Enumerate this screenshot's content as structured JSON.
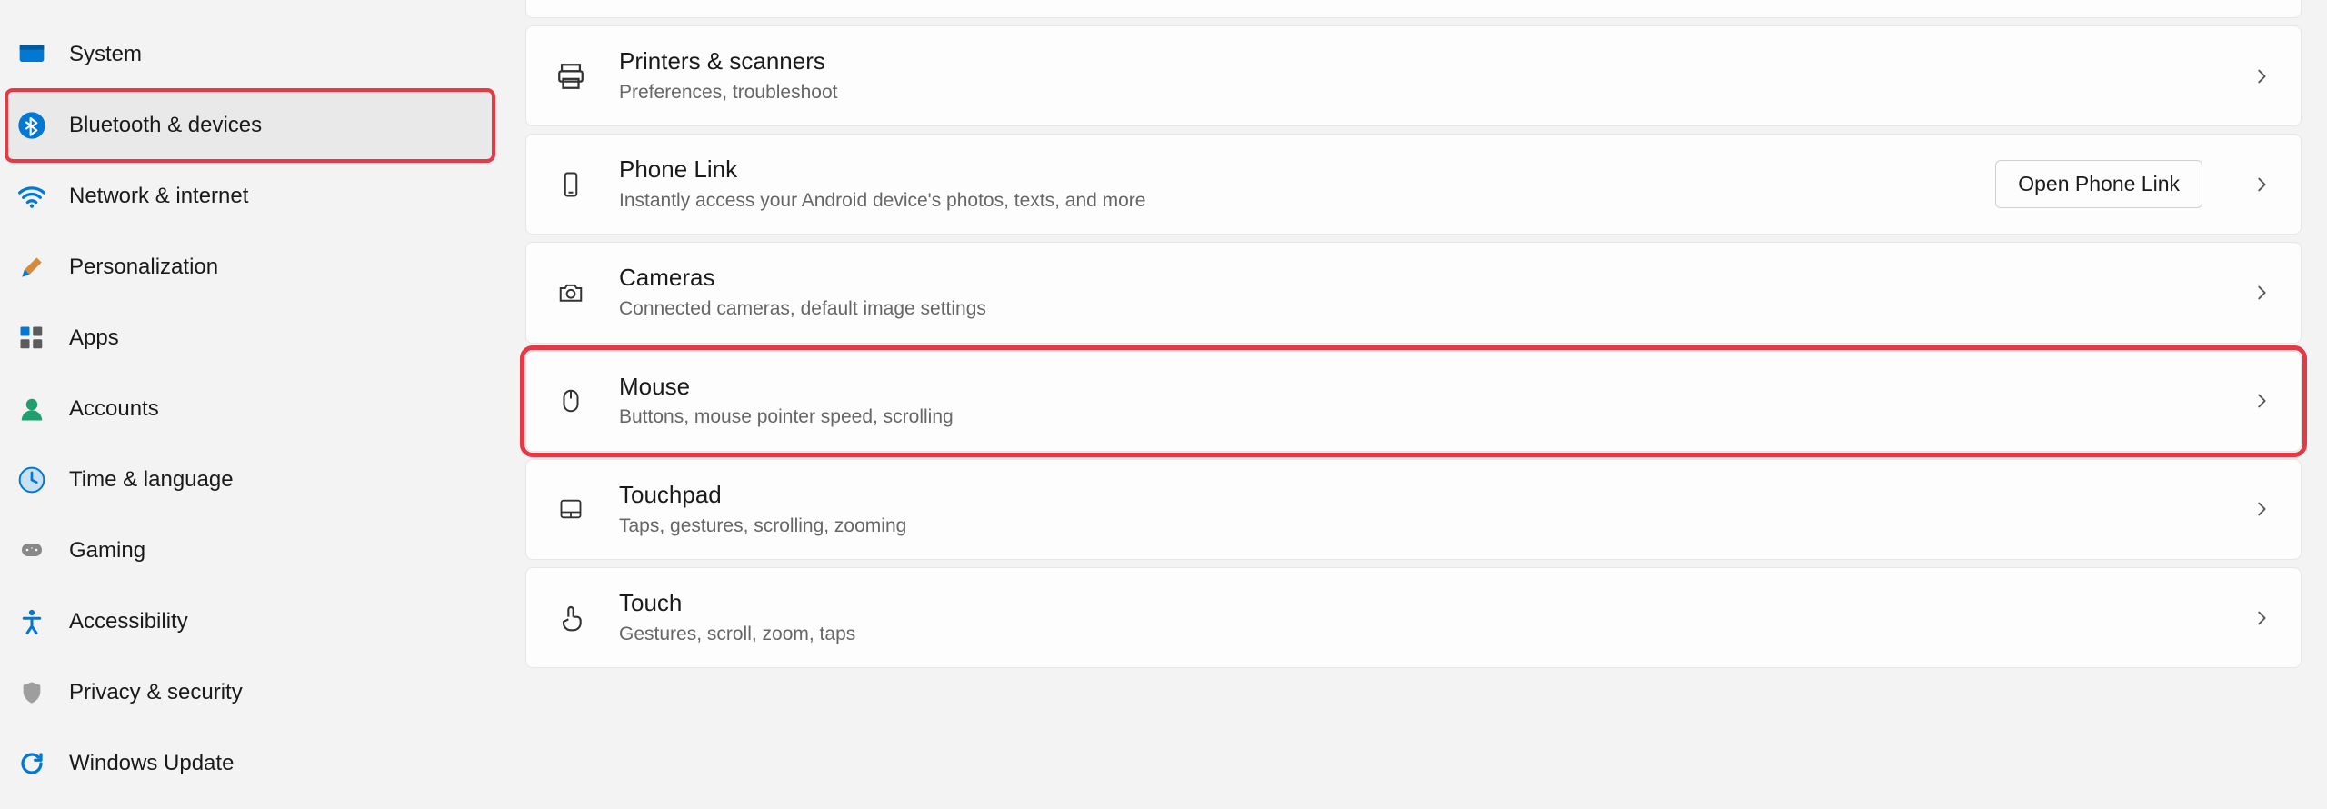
{
  "sidebar": {
    "items": [
      {
        "id": "system",
        "label": "System"
      },
      {
        "id": "bluetooth",
        "label": "Bluetooth & devices"
      },
      {
        "id": "network",
        "label": "Network & internet"
      },
      {
        "id": "personalization",
        "label": "Personalization"
      },
      {
        "id": "apps",
        "label": "Apps"
      },
      {
        "id": "accounts",
        "label": "Accounts"
      },
      {
        "id": "time",
        "label": "Time & language"
      },
      {
        "id": "gaming",
        "label": "Gaming"
      },
      {
        "id": "accessibility",
        "label": "Accessibility"
      },
      {
        "id": "privacy",
        "label": "Privacy & security"
      },
      {
        "id": "update",
        "label": "Windows Update"
      }
    ]
  },
  "main": {
    "items": [
      {
        "id": "printers",
        "title": "Printers & scanners",
        "subtitle": "Preferences, troubleshoot"
      },
      {
        "id": "phone",
        "title": "Phone Link",
        "subtitle": "Instantly access your Android device's photos, texts, and more",
        "button": "Open Phone Link"
      },
      {
        "id": "cameras",
        "title": "Cameras",
        "subtitle": "Connected cameras, default image settings"
      },
      {
        "id": "mouse",
        "title": "Mouse",
        "subtitle": "Buttons, mouse pointer speed, scrolling"
      },
      {
        "id": "touchpad",
        "title": "Touchpad",
        "subtitle": "Taps, gestures, scrolling, zooming"
      },
      {
        "id": "touch",
        "title": "Touch",
        "subtitle": "Gestures, scroll, zoom, taps"
      }
    ]
  }
}
